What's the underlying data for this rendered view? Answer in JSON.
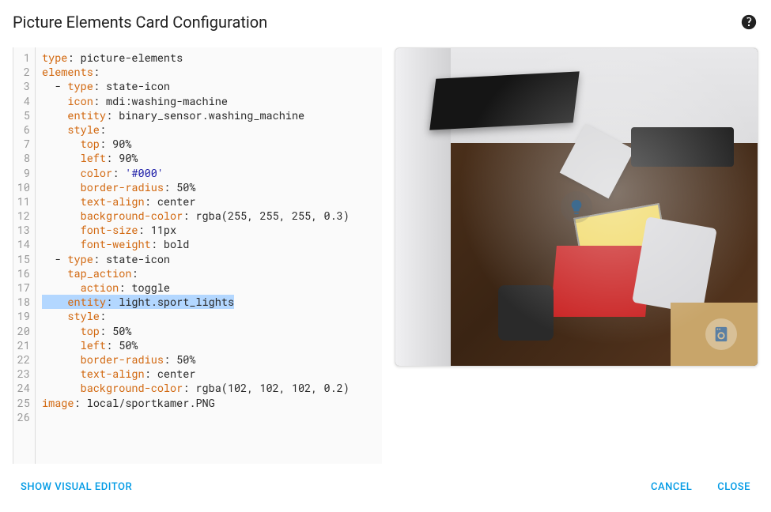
{
  "header": {
    "title": "Picture Elements Card Configuration"
  },
  "code": {
    "lines": [
      {
        "n": 1,
        "segs": [
          {
            "t": "type",
            "c": "k"
          },
          {
            "t": ": picture-elements",
            "c": "v"
          }
        ]
      },
      {
        "n": 2,
        "segs": [
          {
            "t": "elements",
            "c": "k"
          },
          {
            "t": ":",
            "c": "v"
          }
        ]
      },
      {
        "n": 3,
        "segs": [
          {
            "t": "  - ",
            "c": "v"
          },
          {
            "t": "type",
            "c": "k"
          },
          {
            "t": ": state-icon",
            "c": "v"
          }
        ]
      },
      {
        "n": 4,
        "segs": [
          {
            "t": "    ",
            "c": "v"
          },
          {
            "t": "icon",
            "c": "k"
          },
          {
            "t": ": mdi:washing-machine",
            "c": "v"
          }
        ]
      },
      {
        "n": 5,
        "segs": [
          {
            "t": "    ",
            "c": "v"
          },
          {
            "t": "entity",
            "c": "k"
          },
          {
            "t": ": binary_sensor.washing_machine",
            "c": "v"
          }
        ]
      },
      {
        "n": 6,
        "segs": [
          {
            "t": "    ",
            "c": "v"
          },
          {
            "t": "style",
            "c": "k"
          },
          {
            "t": ":",
            "c": "v"
          }
        ]
      },
      {
        "n": 7,
        "segs": [
          {
            "t": "      ",
            "c": "v"
          },
          {
            "t": "top",
            "c": "k"
          },
          {
            "t": ": 90%",
            "c": "v"
          }
        ]
      },
      {
        "n": 8,
        "segs": [
          {
            "t": "      ",
            "c": "v"
          },
          {
            "t": "left",
            "c": "k"
          },
          {
            "t": ": 90%",
            "c": "v"
          }
        ]
      },
      {
        "n": 9,
        "segs": [
          {
            "t": "      ",
            "c": "v"
          },
          {
            "t": "color",
            "c": "k"
          },
          {
            "t": ": ",
            "c": "v"
          },
          {
            "t": "'#000'",
            "c": "s"
          }
        ]
      },
      {
        "n": 10,
        "segs": [
          {
            "t": "      ",
            "c": "v"
          },
          {
            "t": "border-radius",
            "c": "k"
          },
          {
            "t": ": 50%",
            "c": "v"
          }
        ]
      },
      {
        "n": 11,
        "segs": [
          {
            "t": "      ",
            "c": "v"
          },
          {
            "t": "text-align",
            "c": "k"
          },
          {
            "t": ": center",
            "c": "v"
          }
        ]
      },
      {
        "n": 12,
        "segs": [
          {
            "t": "      ",
            "c": "v"
          },
          {
            "t": "background-color",
            "c": "k"
          },
          {
            "t": ": rgba(255, 255, 255, 0.3)",
            "c": "v"
          }
        ]
      },
      {
        "n": 13,
        "segs": [
          {
            "t": "      ",
            "c": "v"
          },
          {
            "t": "font-size",
            "c": "k"
          },
          {
            "t": ": 11px",
            "c": "v"
          }
        ]
      },
      {
        "n": 14,
        "segs": [
          {
            "t": "      ",
            "c": "v"
          },
          {
            "t": "font-weight",
            "c": "k"
          },
          {
            "t": ": bold",
            "c": "v"
          }
        ]
      },
      {
        "n": 15,
        "segs": [
          {
            "t": "  - ",
            "c": "v"
          },
          {
            "t": "type",
            "c": "k"
          },
          {
            "t": ": state-icon",
            "c": "v"
          }
        ]
      },
      {
        "n": 16,
        "segs": [
          {
            "t": "    ",
            "c": "v"
          },
          {
            "t": "tap_action",
            "c": "k"
          },
          {
            "t": ":",
            "c": "v"
          }
        ]
      },
      {
        "n": 17,
        "segs": [
          {
            "t": "      ",
            "c": "v"
          },
          {
            "t": "action",
            "c": "k"
          },
          {
            "t": ": toggle",
            "c": "v"
          }
        ]
      },
      {
        "n": 18,
        "sel": true,
        "segs": [
          {
            "t": "    ",
            "c": "v"
          },
          {
            "t": "entity",
            "c": "k"
          },
          {
            "t": ": light.sport_lights",
            "c": "v"
          }
        ]
      },
      {
        "n": 19,
        "segs": [
          {
            "t": "    ",
            "c": "v"
          },
          {
            "t": "style",
            "c": "k"
          },
          {
            "t": ":",
            "c": "v"
          }
        ]
      },
      {
        "n": 20,
        "segs": [
          {
            "t": "      ",
            "c": "v"
          },
          {
            "t": "top",
            "c": "k"
          },
          {
            "t": ": 50%",
            "c": "v"
          }
        ]
      },
      {
        "n": 21,
        "segs": [
          {
            "t": "      ",
            "c": "v"
          },
          {
            "t": "left",
            "c": "k"
          },
          {
            "t": ": 50%",
            "c": "v"
          }
        ]
      },
      {
        "n": 22,
        "segs": [
          {
            "t": "      ",
            "c": "v"
          },
          {
            "t": "border-radius",
            "c": "k"
          },
          {
            "t": ": 50%",
            "c": "v"
          }
        ]
      },
      {
        "n": 23,
        "segs": [
          {
            "t": "      ",
            "c": "v"
          },
          {
            "t": "text-align",
            "c": "k"
          },
          {
            "t": ": center",
            "c": "v"
          }
        ]
      },
      {
        "n": 24,
        "segs": [
          {
            "t": "      ",
            "c": "v"
          },
          {
            "t": "background-color",
            "c": "k"
          },
          {
            "t": ": rgba(102, 102, 102, 0.2)",
            "c": "v"
          }
        ]
      },
      {
        "n": 25,
        "segs": [
          {
            "t": "image",
            "c": "k"
          },
          {
            "t": ": local/sportkamer.PNG",
            "c": "v"
          }
        ]
      },
      {
        "n": 26,
        "segs": []
      }
    ]
  },
  "footer": {
    "show_visual": "Show Visual Editor",
    "cancel": "Cancel",
    "close": "Close"
  }
}
